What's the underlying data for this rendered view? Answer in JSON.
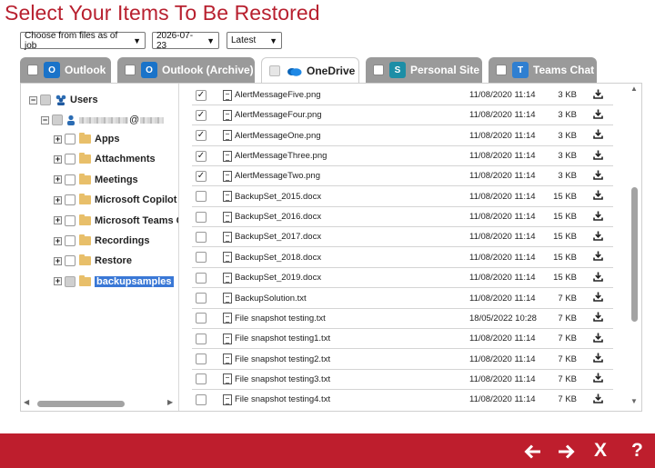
{
  "title": "Select Your Items To Be Restored",
  "filters": {
    "job_select": "Choose from files as of job",
    "date_select": "2026-07-23",
    "version_select": "Latest"
  },
  "tabs": [
    {
      "label": "Outlook",
      "icon": "outlook-icon",
      "color": "#1a73c9"
    },
    {
      "label": "Outlook (Archive)",
      "icon": "outlook-archive-icon",
      "color": "#1a73c9"
    },
    {
      "label": "OneDrive",
      "icon": "onedrive-icon",
      "color": "#1473c6",
      "active": true
    },
    {
      "label": "Personal Site",
      "icon": "sharepoint-icon",
      "color": "#1d8ea6"
    },
    {
      "label": "Teams Chat",
      "icon": "teams-icon",
      "color": "#2f7fd1"
    }
  ],
  "tree": {
    "root_label": "Users",
    "user_email_visible": "@",
    "folders": [
      "Apps",
      "Attachments",
      "Meetings",
      "Microsoft Copilot C",
      "Microsoft Teams Cl",
      "Recordings",
      "Restore",
      "backupsamples"
    ]
  },
  "files": [
    {
      "name": "AlertMessageFive.png",
      "date": "11/08/2020 11:14",
      "size": "3 KB",
      "checked": true
    },
    {
      "name": "AlertMessageFour.png",
      "date": "11/08/2020 11:14",
      "size": "3 KB",
      "checked": true
    },
    {
      "name": "AlertMessageOne.png",
      "date": "11/08/2020 11:14",
      "size": "3 KB",
      "checked": true
    },
    {
      "name": "AlertMessageThree.png",
      "date": "11/08/2020 11:14",
      "size": "3 KB",
      "checked": true
    },
    {
      "name": "AlertMessageTwo.png",
      "date": "11/08/2020 11:14",
      "size": "3 KB",
      "checked": true
    },
    {
      "name": "BackupSet_2015.docx",
      "date": "11/08/2020 11:14",
      "size": "15 KB",
      "checked": false
    },
    {
      "name": "BackupSet_2016.docx",
      "date": "11/08/2020 11:14",
      "size": "15 KB",
      "checked": false
    },
    {
      "name": "BackupSet_2017.docx",
      "date": "11/08/2020 11:14",
      "size": "15 KB",
      "checked": false
    },
    {
      "name": "BackupSet_2018.docx",
      "date": "11/08/2020 11:14",
      "size": "15 KB",
      "checked": false
    },
    {
      "name": "BackupSet_2019.docx",
      "date": "11/08/2020 11:14",
      "size": "15 KB",
      "checked": false
    },
    {
      "name": "BackupSolution.txt",
      "date": "11/08/2020 11:14",
      "size": "7 KB",
      "checked": false
    },
    {
      "name": "File snapshot testing.txt",
      "date": "18/05/2022 10:28",
      "size": "7 KB",
      "checked": false
    },
    {
      "name": "File snapshot testing1.txt",
      "date": "11/08/2020 11:14",
      "size": "7 KB",
      "checked": false
    },
    {
      "name": "File snapshot testing2.txt",
      "date": "11/08/2020 11:14",
      "size": "7 KB",
      "checked": false
    },
    {
      "name": "File snapshot testing3.txt",
      "date": "11/08/2020 11:14",
      "size": "7 KB",
      "checked": false
    },
    {
      "name": "File snapshot testing4.txt",
      "date": "11/08/2020 11:14",
      "size": "7 KB",
      "checked": false
    }
  ],
  "footer_buttons": [
    {
      "name": "back-button",
      "glyph": "🡐"
    },
    {
      "name": "next-button",
      "glyph": "🡒"
    },
    {
      "name": "close-button",
      "glyph": "X"
    },
    {
      "name": "help-button",
      "glyph": "?"
    }
  ],
  "colors": {
    "brand": "#be1e2d",
    "title": "#b8202f",
    "selection": "#3a78d6"
  }
}
